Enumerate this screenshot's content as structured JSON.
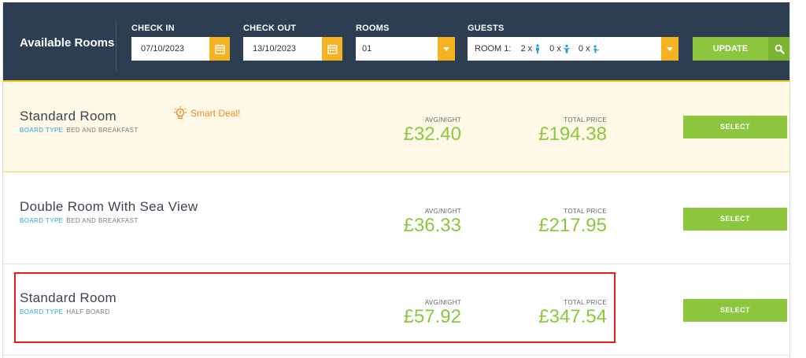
{
  "header": {
    "title": "Available Rooms",
    "check_in": {
      "label": "CHECK IN",
      "value": "07/10/2023",
      "icon": "calendar-icon"
    },
    "check_out": {
      "label": "CHECK OUT",
      "value": "13/10/2023",
      "icon": "calendar-icon"
    },
    "rooms": {
      "label": "ROOMS",
      "value": "01"
    },
    "guests": {
      "label": "GUESTS",
      "room_label": "ROOM 1:",
      "adults": "2 x",
      "children": "0 x",
      "infants": "0 x"
    },
    "update_label": "UPDATE",
    "search_icon": "search-icon"
  },
  "colors": {
    "header_bg": "#2d3e52",
    "accent_yellow": "#f5b221",
    "green": "#8cc63f",
    "board_blue": "#2ba3d6",
    "smart_orange": "#f08a24",
    "highlight_red": "#e31b1b"
  },
  "rooms": [
    {
      "name": "Standard Room",
      "board_type_label": "BOARD TYPE",
      "board_type_value": "BED AND BREAKFAST",
      "avg_label": "AVG/NIGHT",
      "avg_price": "£32.40",
      "total_label": "TOTAL PRICE",
      "total_price": "£194.38",
      "select_label": "SELECT",
      "badge": "Smart Deal!"
    },
    {
      "name": "Double Room With Sea View",
      "board_type_label": "BOARD TYPE",
      "board_type_value": "BED AND BREAKFAST",
      "avg_label": "AVG/NIGHT",
      "avg_price": "£36.33",
      "total_label": "TOTAL PRICE",
      "total_price": "£217.95",
      "select_label": "SELECT"
    },
    {
      "name": "Standard Room",
      "board_type_label": "BOARD TYPE",
      "board_type_value": "HALF BOARD",
      "avg_label": "AVG/NIGHT",
      "avg_price": "£57.92",
      "total_label": "TOTAL PRICE",
      "total_price": "£347.54",
      "select_label": "SELECT"
    }
  ]
}
